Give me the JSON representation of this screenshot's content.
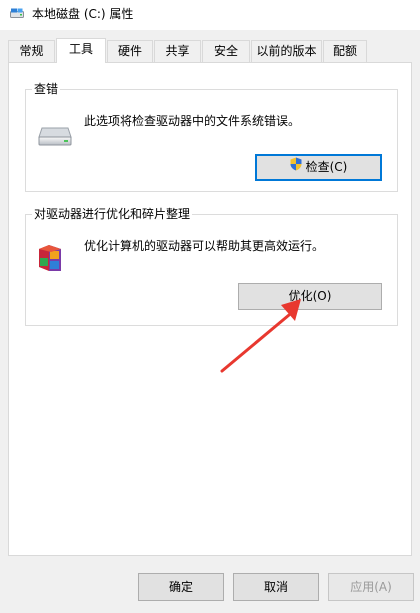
{
  "window": {
    "title": "本地磁盘 (C:) 属性",
    "icon": "drive-icon"
  },
  "tabs": [
    {
      "label": "常规",
      "active": false
    },
    {
      "label": "工具",
      "active": true
    },
    {
      "label": "硬件",
      "active": false
    },
    {
      "label": "共享",
      "active": false
    },
    {
      "label": "安全",
      "active": false
    },
    {
      "label": "以前的版本",
      "active": false
    },
    {
      "label": "配额",
      "active": false
    }
  ],
  "error_check": {
    "title": "查错",
    "description": "此选项将检查驱动器中的文件系统错误。",
    "icon": "hard-drive-icon",
    "button_label": "检查(C)",
    "button_icon": "uac-shield-icon"
  },
  "optimize": {
    "title": "对驱动器进行优化和碎片整理",
    "description": "优化计算机的驱动器可以帮助其更高效运行。",
    "icon": "defrag-blocks-icon",
    "button_label": "优化(O)"
  },
  "footer": {
    "ok_label": "确定",
    "cancel_label": "取消",
    "apply_label": "应用(A)",
    "apply_enabled": false
  },
  "annotation": {
    "arrow_color": "#e8382f",
    "arrow_icon": "red-arrow-icon"
  },
  "colors": {
    "accent": "#0078d7",
    "window_bg": "#f0f0f0",
    "panel_bg": "#ffffff"
  }
}
